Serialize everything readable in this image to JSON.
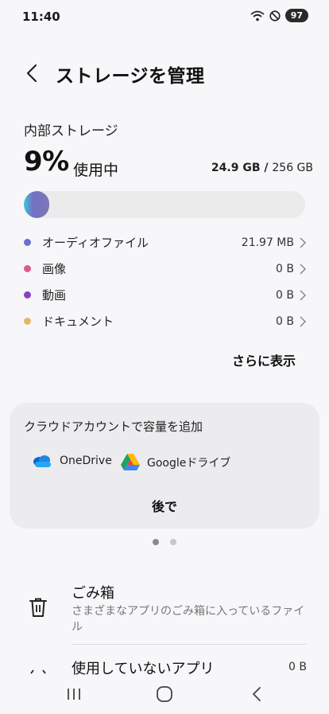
{
  "status_bar": {
    "time": "11:40",
    "battery": "97"
  },
  "header": {
    "title": "ストレージを管理"
  },
  "storage": {
    "section_title": "内部ストレージ",
    "percent": "9%",
    "percent_label": "使用中",
    "used": "24.9 GB",
    "separator": " / ",
    "total": "256 GB",
    "usage_fraction": 0.09,
    "categories": [
      {
        "label": "オーディオファイル",
        "value": "21.97 MB",
        "color": "#6d6fd1"
      },
      {
        "label": "画像",
        "value": "0 B",
        "color": "#e05a86"
      },
      {
        "label": "動画",
        "value": "0 B",
        "color": "#8a3fc2"
      },
      {
        "label": "ドキュメント",
        "value": "0 B",
        "color": "#e2b86b"
      }
    ],
    "more_label": "さらに表示"
  },
  "cloud_card": {
    "title": "クラウドアカウントで容量を追加",
    "options": [
      {
        "label": "OneDrive",
        "icon": "onedrive-icon"
      },
      {
        "label": "Googleドライブ",
        "icon": "google-drive-icon"
      }
    ],
    "later_label": "後で"
  },
  "pager": {
    "count": 2,
    "active": 0
  },
  "trash": {
    "title": "ごみ箱",
    "description": "さまざまなアプリのごみ箱に入っているファイル"
  },
  "unused_apps": {
    "title": "使用していないアプリ",
    "value": "0 B"
  },
  "colors": {
    "background": "#f7f7f9",
    "card": "#ececef",
    "track": "#ebebeb"
  }
}
